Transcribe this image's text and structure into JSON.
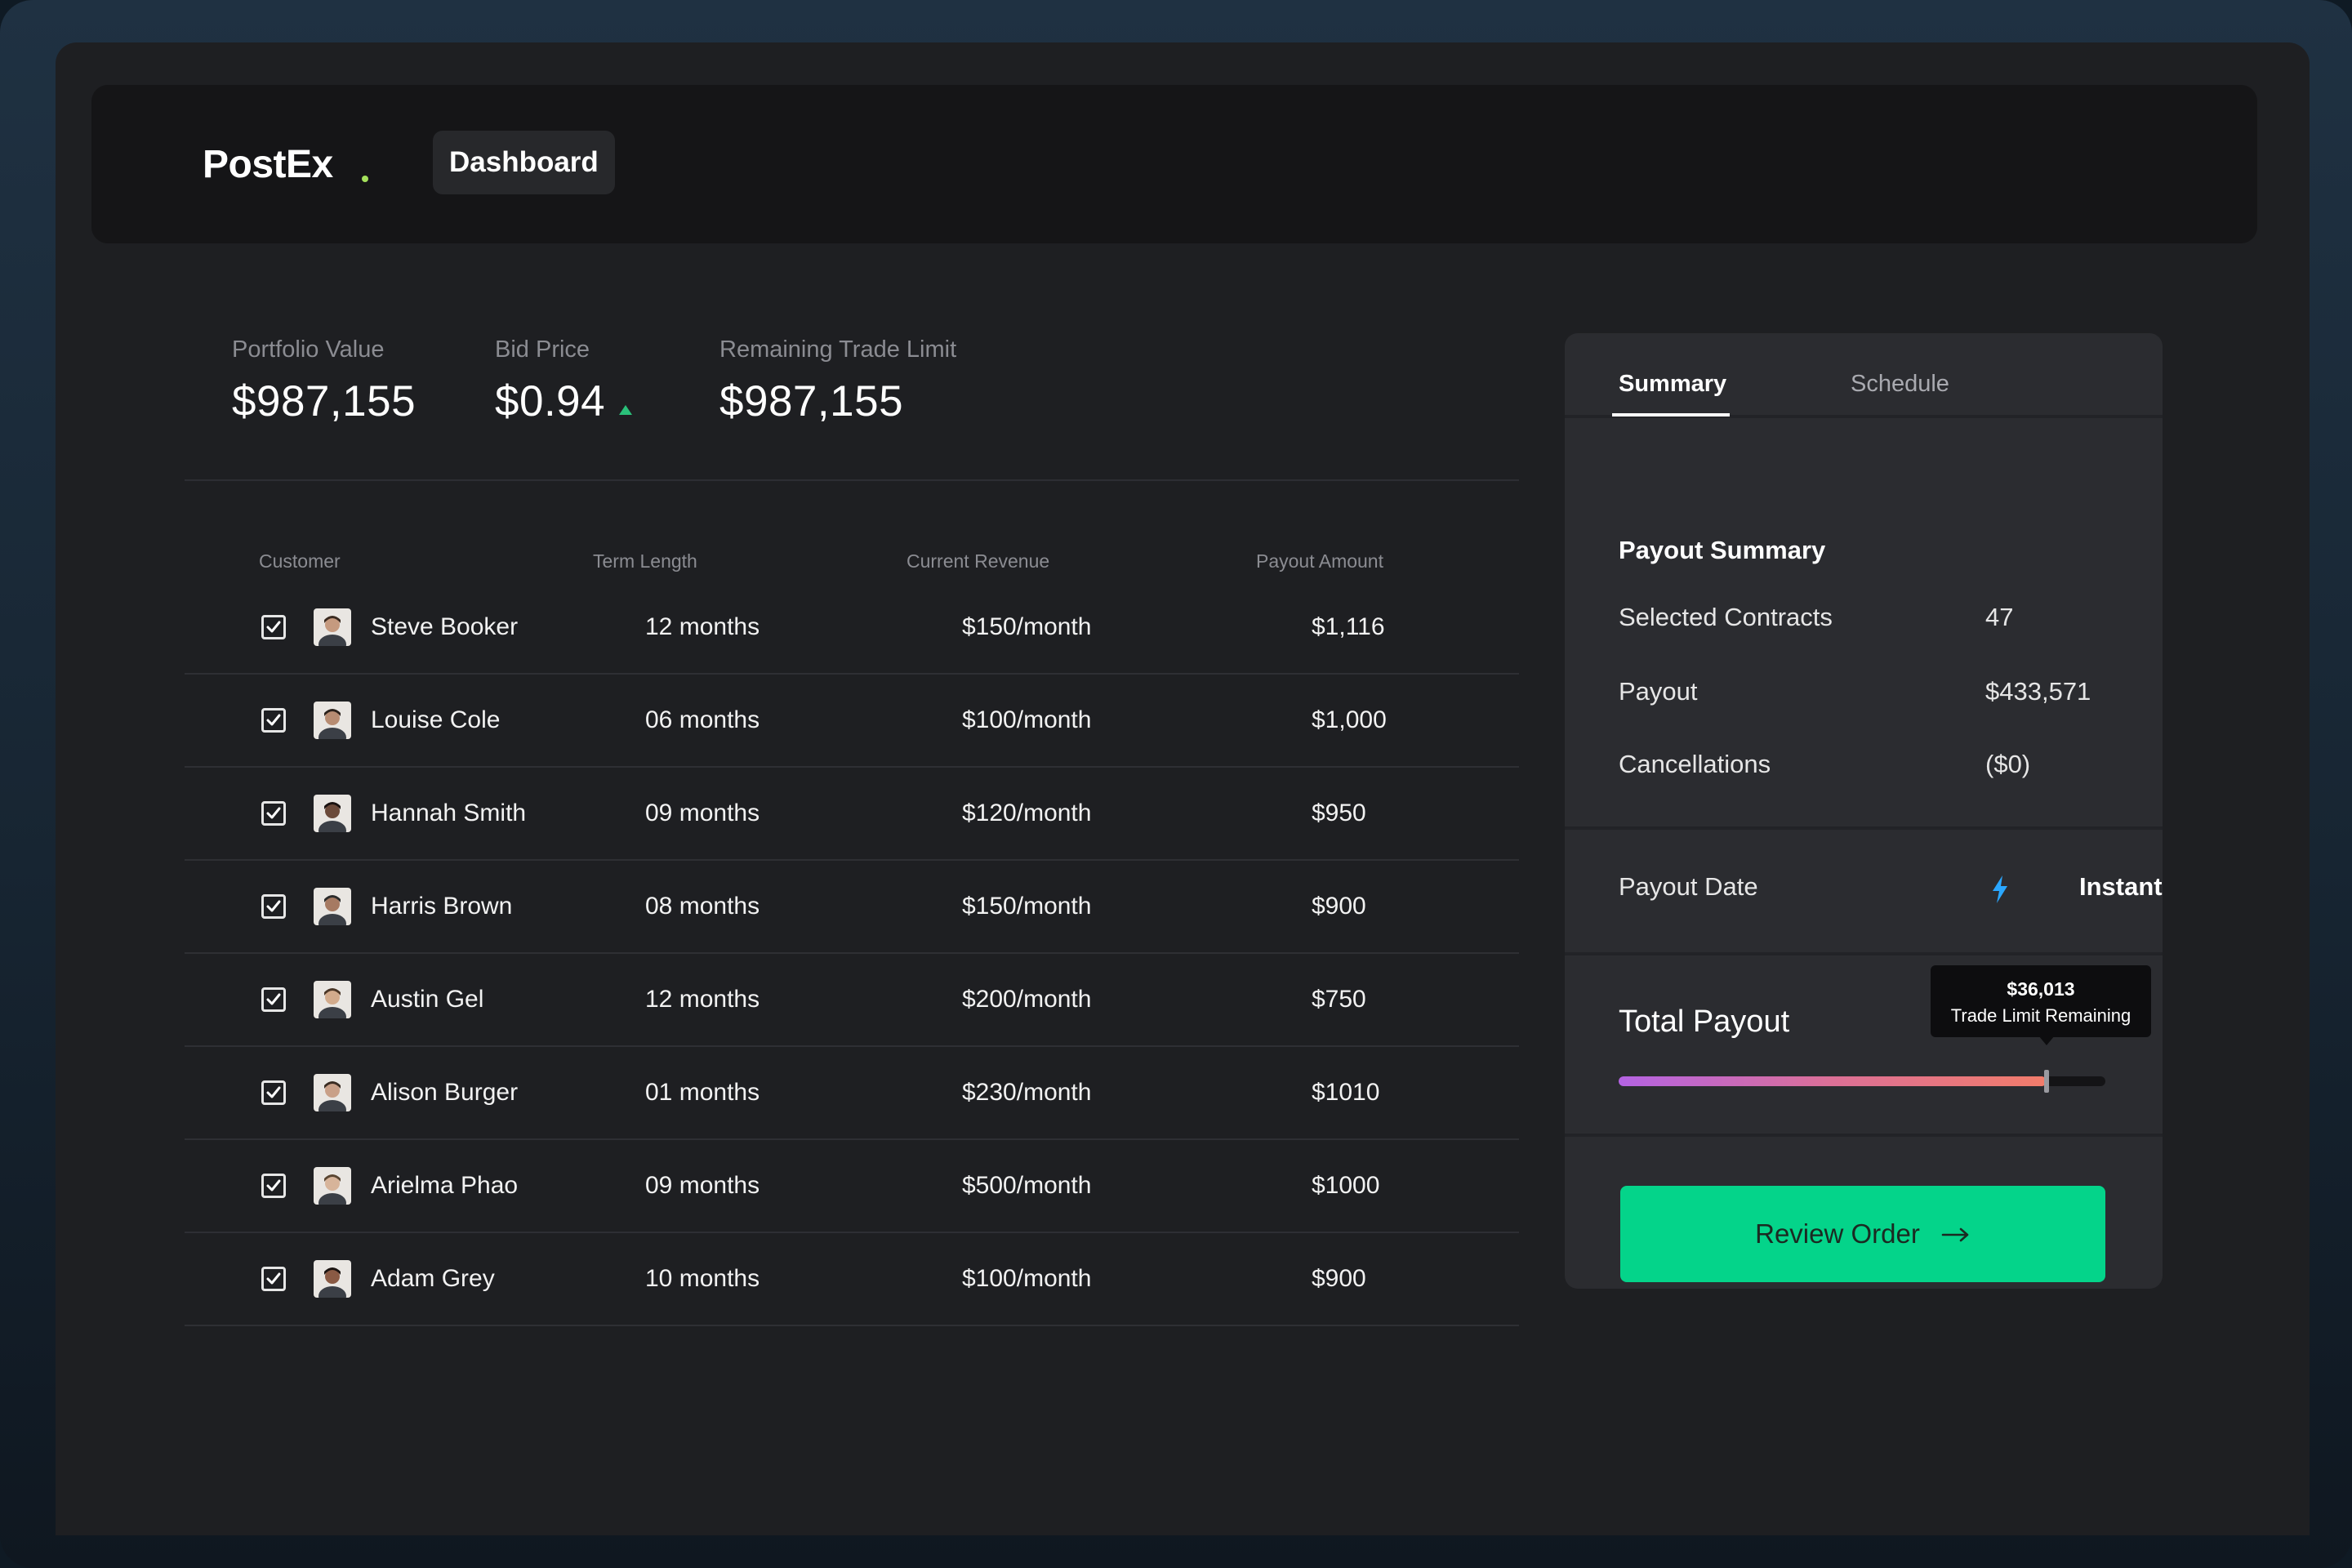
{
  "app": {
    "logo": "PostEx",
    "nav_active": "Dashboard"
  },
  "stats": [
    {
      "label": "Portfolio Value",
      "value": "$987,155"
    },
    {
      "label": "Bid Price",
      "value": "$0.94",
      "trend": "up"
    },
    {
      "label": "Remaining Trade Limit",
      "value": "$987,155"
    }
  ],
  "table": {
    "headers": [
      "Customer",
      "Term Length",
      "Current Revenue",
      "Payout Amount"
    ],
    "rows": [
      {
        "name": "Steve Booker",
        "term": "12 months",
        "revenue": "$150/month",
        "payout": "$1,116",
        "checked": true
      },
      {
        "name": "Louise Cole",
        "term": "06 months",
        "revenue": "$100/month",
        "payout": "$1,000",
        "checked": true
      },
      {
        "name": "Hannah Smith",
        "term": "09 months",
        "revenue": "$120/month",
        "payout": "$950",
        "checked": true
      },
      {
        "name": "Harris Brown",
        "term": "08 months",
        "revenue": "$150/month",
        "payout": "$900",
        "checked": true
      },
      {
        "name": "Austin Gel",
        "term": "12 months",
        "revenue": "$200/month",
        "payout": "$750",
        "checked": true
      },
      {
        "name": "Alison Burger",
        "term": "01 months",
        "revenue": "$230/month",
        "payout": "$1010",
        "checked": true
      },
      {
        "name": "Arielma Phao",
        "term": "09 months",
        "revenue": "$500/month",
        "payout": "$1000",
        "checked": true
      },
      {
        "name": "Adam Grey",
        "term": "10 months",
        "revenue": "$100/month",
        "payout": "$900",
        "checked": true
      }
    ]
  },
  "panel": {
    "tabs": [
      "Summary",
      "Schedule"
    ],
    "active_tab": "Summary",
    "section_title": "Payout Summary",
    "summary": [
      {
        "label": "Selected Contracts",
        "value": "47"
      },
      {
        "label": "Payout",
        "value": "$433,571"
      },
      {
        "label": "Cancellations",
        "value": "($0)"
      }
    ],
    "payout_date": {
      "label": "Payout Date",
      "value": "Instant",
      "icon": "lightning-bolt-icon"
    },
    "total_payout": {
      "label": "Total Payout",
      "tooltip_value": "$36,013",
      "tooltip_label": "Trade Limit Remaining",
      "slider_fraction": 0.88
    },
    "review_button": "Review Order"
  },
  "colors": {
    "accent_green": "#04d48a",
    "trend_up": "#2ac07a",
    "bolt_blue": "#2aa7ff",
    "slider_start": "#b463e3",
    "slider_end": "#f27c6a"
  }
}
